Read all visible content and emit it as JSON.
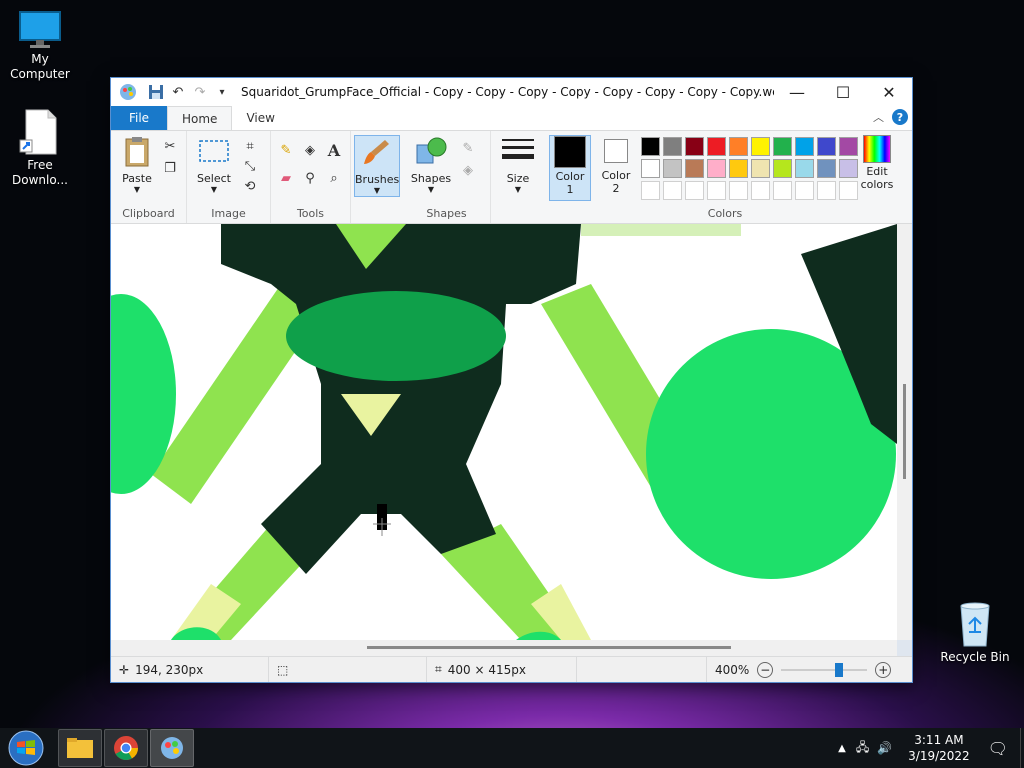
{
  "desktop": {
    "icons": [
      {
        "label": "My Computer"
      },
      {
        "label": "Free Downlo..."
      },
      {
        "label": "Recycle Bin"
      }
    ]
  },
  "window": {
    "title": "Squaridot_GrumpFace_Official - Copy - Copy - Copy - Copy - Copy - Copy - Copy - Copy.webp -...",
    "tabs": {
      "file": "File",
      "home": "Home",
      "view": "View"
    },
    "ribbon": {
      "clipboard": {
        "label": "Clipboard",
        "paste": "Paste"
      },
      "image": {
        "label": "Image",
        "select": "Select"
      },
      "tools": {
        "label": "Tools"
      },
      "brushes": {
        "label": "Brushes"
      },
      "shapes": {
        "label": "Shapes",
        "shapes_btn": "Shapes"
      },
      "size": {
        "label": "Size"
      },
      "colors": {
        "label": "Colors",
        "color1": "Color 1",
        "color2": "Color 2",
        "edit": "Edit colors",
        "color1_value": "#000000",
        "color2_value": "#ffffff",
        "palette_row1": [
          "#000000",
          "#7f7f7f",
          "#880015",
          "#ed1c24",
          "#ff7f27",
          "#fff200",
          "#22b14c",
          "#00a2e8",
          "#3f48cc",
          "#a349a4"
        ],
        "palette_row2": [
          "#ffffff",
          "#c3c3c3",
          "#b97a57",
          "#ffaec9",
          "#ffc90e",
          "#efe4b0",
          "#b5e61d",
          "#99d9ea",
          "#7092be",
          "#c8bfe7"
        ],
        "palette_row3": [
          "#ffffff",
          "#ffffff",
          "#ffffff",
          "#ffffff",
          "#ffffff",
          "#ffffff",
          "#ffffff",
          "#ffffff",
          "#ffffff",
          "#ffffff"
        ]
      }
    },
    "status": {
      "cursor_pos": "194, 230px",
      "image_size": "400 × 415px",
      "zoom": "400%"
    }
  },
  "taskbar": {
    "time": "3:11 AM",
    "date": "3/19/2022"
  }
}
